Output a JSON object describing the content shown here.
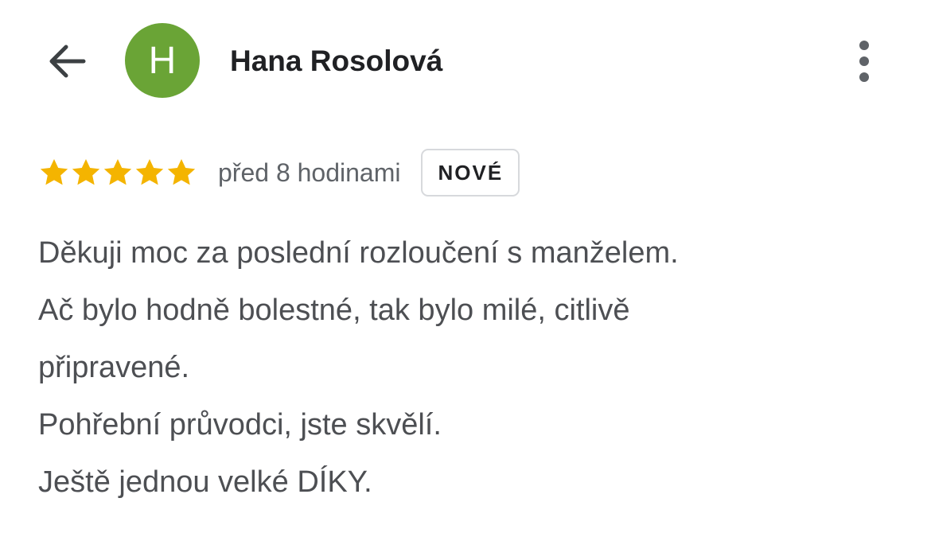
{
  "header": {
    "back_icon": "arrow-left-icon",
    "avatar_letter": "H",
    "avatar_color": "#6aa436",
    "user_name": "Hana Rosolová",
    "more_icon": "more-vert-icon"
  },
  "review": {
    "rating": 5,
    "rating_max": 5,
    "star_color": "#f4b400",
    "time_ago": "před 8 hodinami",
    "badge": "NOVÉ",
    "lines": [
      "Děkuji moc za poslední rozloučení s manželem.",
      "Ač bylo hodně bolestné, tak bylo milé, citlivě",
      "připravené.",
      "Pohřební průvodci, jste skvělí.",
      "Ještě jednou velké DÍKY."
    ]
  }
}
